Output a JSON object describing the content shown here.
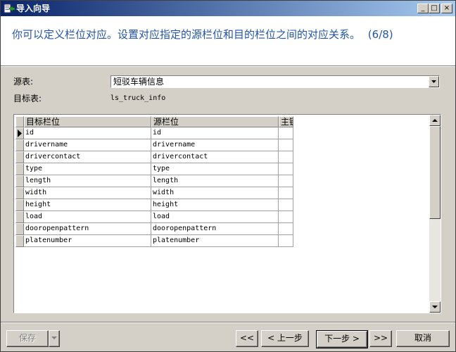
{
  "window": {
    "title": "导入向导",
    "controls": {
      "minimize": "_",
      "maximize": "□",
      "close": "×"
    }
  },
  "header": {
    "instruction": "你可以定义栏位对应。设置对应指定的源栏位和目的栏位之间的对应关系。",
    "step": "(6/8)"
  },
  "form": {
    "source_label": "源表:",
    "source_value": "短驳车辆信息",
    "target_label": "目标表:",
    "target_value": "ls_truck_info"
  },
  "grid": {
    "columns": [
      "目标栏位",
      "源栏位",
      "主键"
    ],
    "rows": [
      {
        "target": "id",
        "source": "id"
      },
      {
        "target": "drivername",
        "source": "drivername"
      },
      {
        "target": "drivercontact",
        "source": "drivercontact"
      },
      {
        "target": "type",
        "source": "type"
      },
      {
        "target": "length",
        "source": "length"
      },
      {
        "target": "width",
        "source": "width"
      },
      {
        "target": "height",
        "source": "height"
      },
      {
        "target": "load",
        "source": "load"
      },
      {
        "target": "dooropenpattern",
        "source": "dooropenpattern"
      },
      {
        "target": "platenumber",
        "source": "platenumber"
      }
    ]
  },
  "footer": {
    "save": "保存",
    "first": "<<",
    "prev": "< 上一步",
    "next": "下一步 >",
    "last": ">>",
    "cancel": "取消"
  },
  "colors": {
    "titlebar_start": "#0a246a",
    "titlebar_end": "#a6caf0",
    "header_text": "#2255a8",
    "face": "#d4d0c8"
  },
  "icons": [
    "import-wizard-icon",
    "row-pointer-icon",
    "dropdown-arrow-icon",
    "scroll-up-icon",
    "scroll-down-icon"
  ]
}
